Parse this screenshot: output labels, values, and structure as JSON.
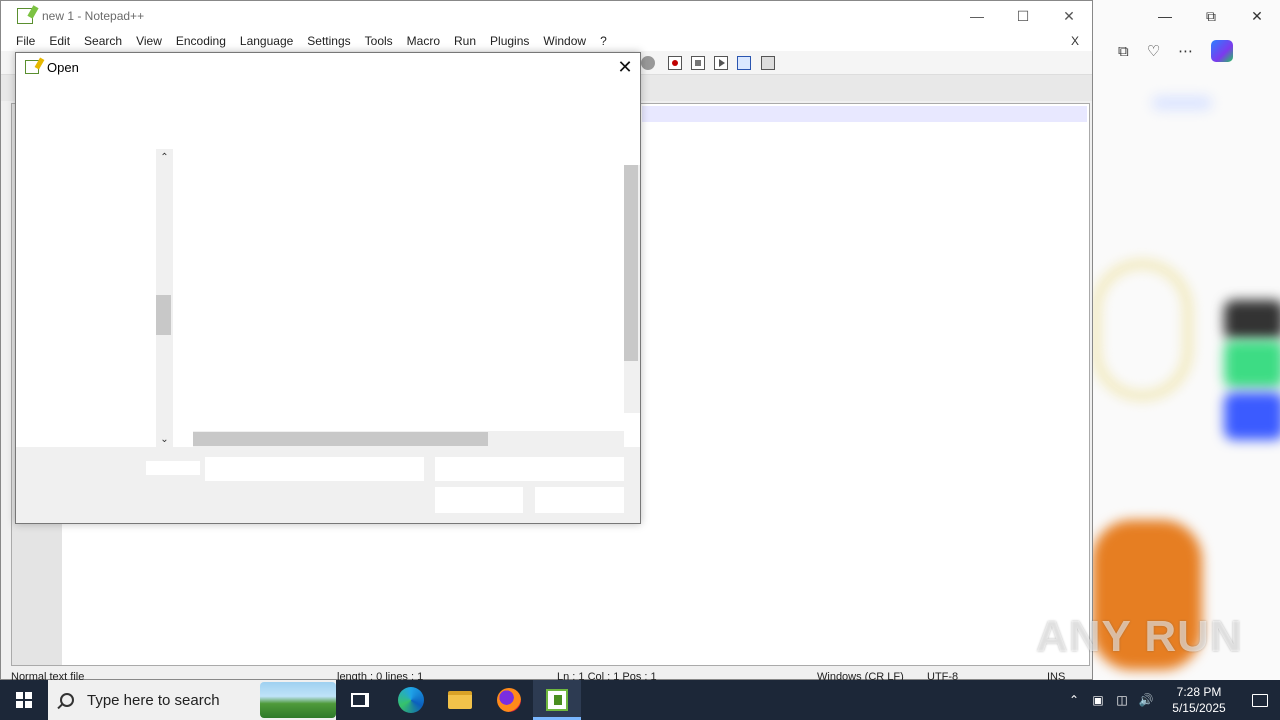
{
  "notepad": {
    "title": "new 1 - Notepad++",
    "menu": [
      "File",
      "Edit",
      "Search",
      "View",
      "Encoding",
      "Language",
      "Settings",
      "Tools",
      "Macro",
      "Run",
      "Plugins",
      "Window",
      "?"
    ],
    "close_doc": "X",
    "status": {
      "type": "Normal text file",
      "length": "length : 0    lines : 1",
      "position": "Ln : 1    Col : 1    Pos : 1",
      "eol": "Windows (CR LF)",
      "encoding": "UTF-8",
      "mode": "INS"
    }
  },
  "dialog": {
    "title": "Open"
  },
  "taskbar": {
    "search_placeholder": "Type here to search",
    "time": "7:28 PM",
    "date": "5/15/2025"
  },
  "watermark": "ANY RUN"
}
